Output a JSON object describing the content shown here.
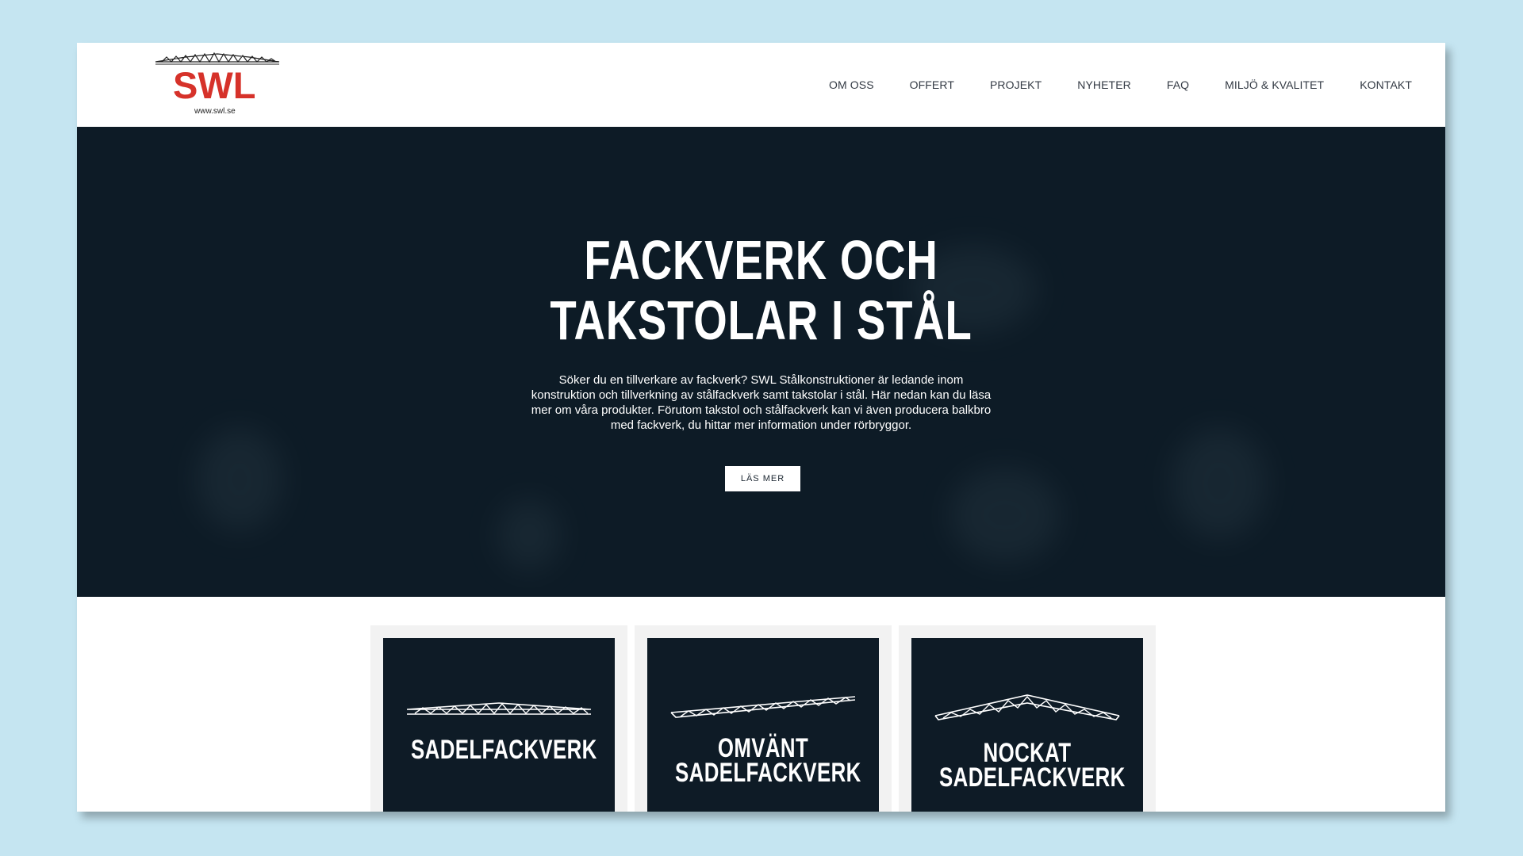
{
  "logo": {
    "text": "SWL",
    "url": "www.swl.se",
    "color": "#d6322a"
  },
  "nav": {
    "items": [
      {
        "label": "OM OSS"
      },
      {
        "label": "OFFERT"
      },
      {
        "label": "PROJEKT"
      },
      {
        "label": "NYHETER"
      },
      {
        "label": "FAQ"
      },
      {
        "label": "MILJÖ & KVALITET"
      },
      {
        "label": "KONTAKT"
      }
    ]
  },
  "hero": {
    "title_line1": "FACKVERK OCH",
    "title_line2": "TAKSTOLAR I STÅL",
    "text": "Söker du en tillverkare av fackverk? SWL Stålkonstruktioner är ledande inom konstruktion och tillverkning av stålfackverk samt takstolar i stål. Här nedan kan du läsa mer om våra produkter. Förutom takstol och stålfackverk kan vi även producera balkbro med fackverk, du hittar mer information under rörbryggor.",
    "button_label": "LÄS MER",
    "background_color": "#0d1b26"
  },
  "cards": [
    {
      "title": "SADELFACKVERK",
      "icon": "saddle-truss-icon"
    },
    {
      "title": "OMVÄNT\nSADELFACKVERK",
      "icon": "inverted-saddle-truss-icon"
    },
    {
      "title": "NOCKAT\nSADELFACKVERK",
      "icon": "ridged-saddle-truss-icon"
    }
  ]
}
